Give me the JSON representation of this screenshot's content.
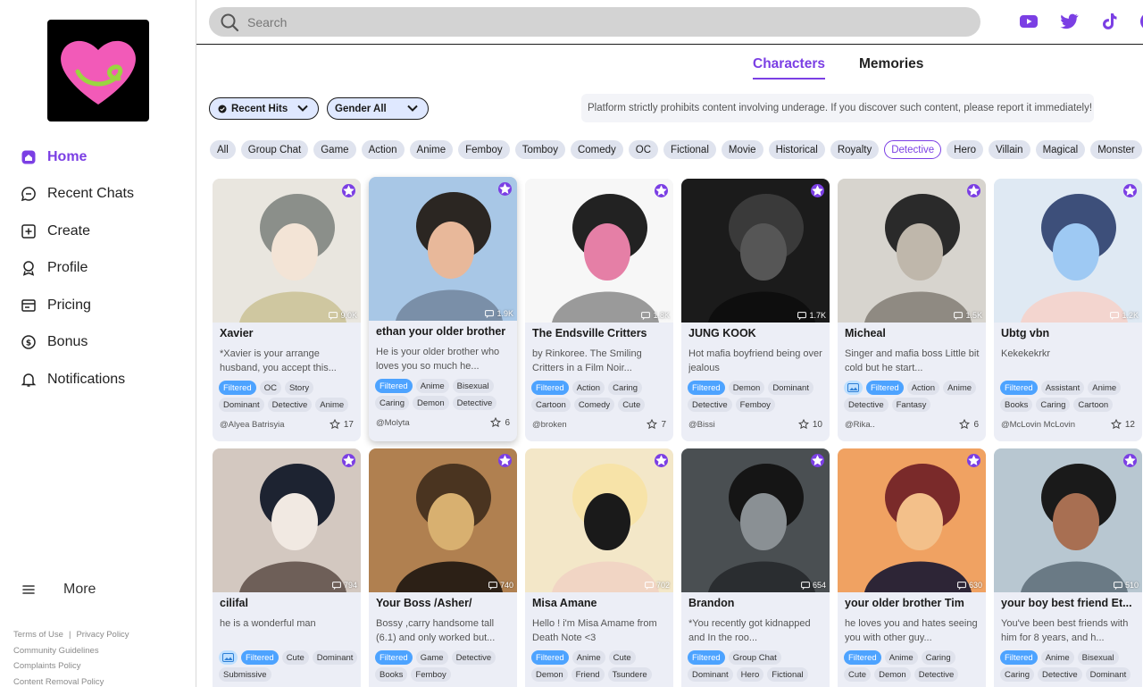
{
  "search": {
    "placeholder": "Search"
  },
  "nav": [
    {
      "label": "Home",
      "icon": "home-icon"
    },
    {
      "label": "Recent Chats",
      "icon": "chat-icon"
    },
    {
      "label": "Create",
      "icon": "plus-square-icon"
    },
    {
      "label": "Profile",
      "icon": "profile-icon"
    },
    {
      "label": "Pricing",
      "icon": "pricing-icon"
    },
    {
      "label": "Bonus",
      "icon": "dollar-icon"
    },
    {
      "label": "Notifications",
      "icon": "bell-icon"
    }
  ],
  "more_label": "More",
  "footer": {
    "terms": "Terms of Use",
    "separator": "|",
    "privacy": "Privacy Policy",
    "community": "Community Guidelines",
    "complaints": "Complaints Policy",
    "removal": "Content Removal Policy"
  },
  "tabs": {
    "characters": "Characters",
    "memories": "Memories"
  },
  "filters": {
    "sort": "Recent Hits",
    "gender": "Gender All"
  },
  "notice": "Platform strictly prohibits content involving underage. If you discover such content, please report it immediately!",
  "categories": [
    "All",
    "Group Chat",
    "Game",
    "Action",
    "Anime",
    "Femboy",
    "Tomboy",
    "Comedy",
    "OC",
    "Fictional",
    "Movie",
    "Historical",
    "Royalty",
    "Detective",
    "Hero",
    "Villain",
    "Magical",
    "Monster",
    "Monster Girl"
  ],
  "active_category": "Detective",
  "colors": {
    "accent": "#7b3fe4",
    "filtered_tag": "#4da3ff",
    "card_bg": "#eceef6"
  },
  "cards": [
    {
      "name": "Xavier",
      "views": "9.0K",
      "desc": "*Xavier is your arrange husband, you accept this...",
      "tags": [
        "Filtered",
        "OC",
        "Story",
        "Dominant",
        "Detective",
        "Anime"
      ],
      "author": "@Alyea Batrisyia",
      "stars": "17"
    },
    {
      "name": "ethan your older brother",
      "views": "1.9K",
      "desc": "He is your older brother who loves you so much he...",
      "tags": [
        "Filtered",
        "Anime",
        "Bisexual",
        "Caring",
        "Demon",
        "Detective"
      ],
      "author": "@Molyta",
      "stars": "6"
    },
    {
      "name": "The Endsville Critters",
      "views": "1.8K",
      "desc": "by Rinkoree. The Smiling Critters in a Film Noir...",
      "tags": [
        "Filtered",
        "Action",
        "Caring",
        "Cartoon",
        "Comedy",
        "Cute"
      ],
      "author": "@broken",
      "stars": "7"
    },
    {
      "name": "JUNG KOOK",
      "views": "1.7K",
      "desc": "Hot mafia boyfriend being over jealous",
      "tags": [
        "Filtered",
        "Demon",
        "Dominant",
        "Detective",
        "Femboy"
      ],
      "author": "@Bissi",
      "stars": "10"
    },
    {
      "name": "Micheal",
      "views": "1.5K",
      "desc": "Singer and mafia boss Little bit cold but he start...",
      "tags": [
        "image",
        "Filtered",
        "Action",
        "Anime",
        "Detective",
        "Fantasy"
      ],
      "author": "@Rika..",
      "stars": "6"
    },
    {
      "name": "Ubtg vbn",
      "views": "1.2K",
      "desc": "Kekekekrkr",
      "tags": [
        "Filtered",
        "Assistant",
        "Anime",
        "Books",
        "Caring",
        "Cartoon"
      ],
      "author": "@McLovin McLovin",
      "stars": "12"
    },
    {
      "name": "cilifal",
      "views": "794",
      "desc": "he is a wonderful man",
      "tags": [
        "image",
        "Filtered",
        "Cute",
        "Dominant",
        "Submissive"
      ],
      "author": "",
      "stars": ""
    },
    {
      "name": "Your Boss /Asher/",
      "views": "740",
      "desc": "Bossy ,carry handsome tall (6.1) and only worked but...",
      "tags": [
        "Filtered",
        "Game",
        "Detective",
        "Books",
        "Femboy"
      ],
      "author": "",
      "stars": ""
    },
    {
      "name": "Misa Amane",
      "views": "702",
      "desc": "Hello ! i'm Misa Amame from Death Note <3",
      "tags": [
        "Filtered",
        "Anime",
        "Cute",
        "Demon",
        "Friend",
        "Tsundere"
      ],
      "author": "",
      "stars": ""
    },
    {
      "name": "Brandon",
      "views": "654",
      "desc": "*You recently got kidnapped and In the roo...",
      "tags": [
        "Filtered",
        "Group Chat",
        "Dominant",
        "Hero",
        "Fictional"
      ],
      "author": "",
      "stars": ""
    },
    {
      "name": "your older brother Tim",
      "views": "630",
      "desc": "he loves you and hates seeing you with other guy...",
      "tags": [
        "Filtered",
        "Anime",
        "Caring",
        "Cute",
        "Demon",
        "Detective"
      ],
      "author": "",
      "stars": ""
    },
    {
      "name": "your boy best friend Et...",
      "views": "510",
      "desc": "You've been best friends with him for 8 years, and h...",
      "tags": [
        "Filtered",
        "Anime",
        "Bisexual",
        "Caring",
        "Detective",
        "Dominant"
      ],
      "author": "",
      "stars": ""
    }
  ]
}
